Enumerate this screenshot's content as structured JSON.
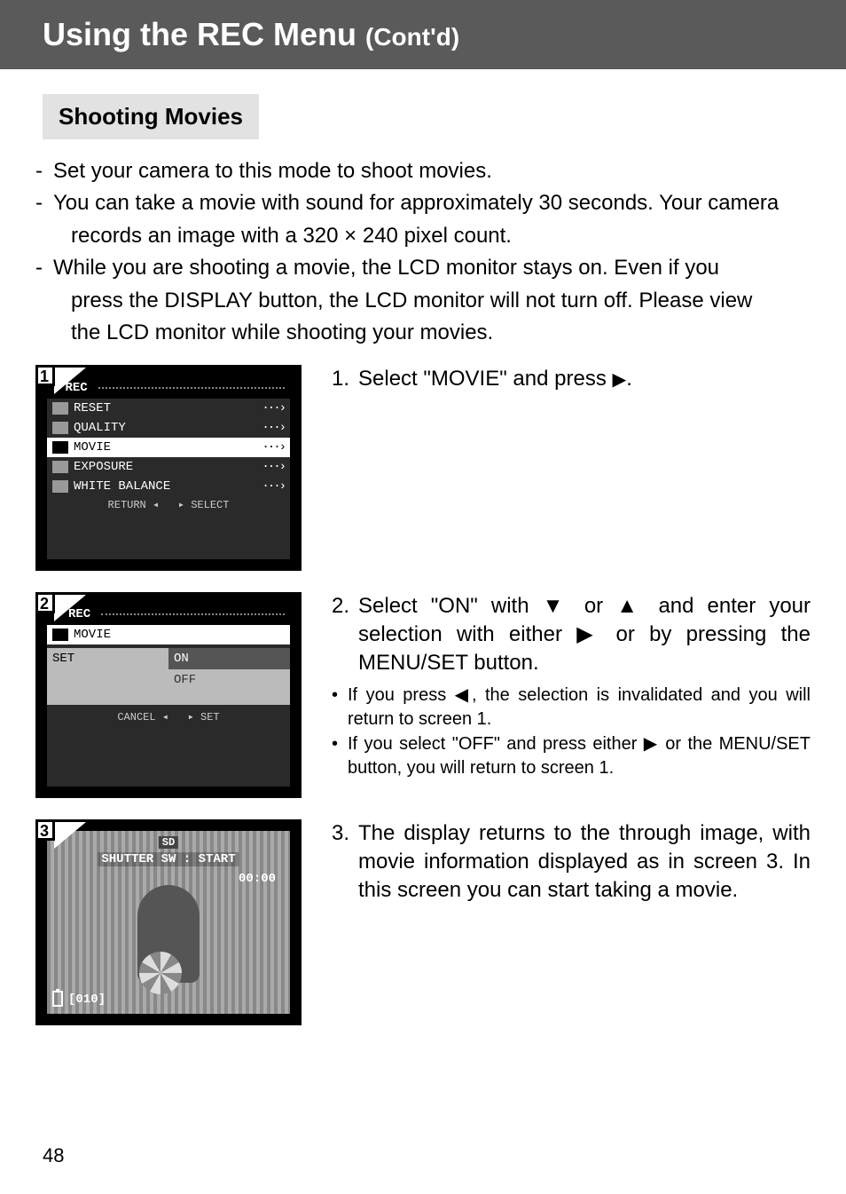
{
  "header": {
    "main": "Using the REC Menu ",
    "sub": "(Cont'd)"
  },
  "section_title": "Shooting Movies",
  "intro": {
    "l1": "Set your camera to this mode to shoot movies.",
    "l2a": "You can take a movie with sound for approximately 30 seconds. Your camera",
    "l2b": "records an image with a 320 × 240 pixel count.",
    "l3a": "While you are shooting a movie, the LCD monitor stays on. Even if you",
    "l3b": "press the DISPLAY button, the LCD monitor will not turn off. Please view",
    "l3c": "the LCD monitor while shooting your movies."
  },
  "screen1": {
    "num": "1",
    "title": "REC",
    "items": [
      "RESET",
      "QUALITY",
      "MOVIE",
      "EXPOSURE",
      "WHITE BALANCE"
    ],
    "selected_index": 2,
    "foot_left": "RETURN",
    "foot_right": "SELECT"
  },
  "step1": {
    "n": "1.",
    "text_a": "Select \"MOVIE\" and press ",
    "text_b": "."
  },
  "screen2": {
    "num": "2",
    "title": "REC",
    "movie_label": "MOVIE",
    "set_label": "SET",
    "on": "ON",
    "off": "OFF",
    "foot_left": "CANCEL",
    "foot_right": "SET"
  },
  "step2": {
    "n": "2.",
    "line": "Select \"ON\" with ▼ or ▲ and enter your selection with either ▶ or by pressing the MENU/SET button.",
    "b1": "If you press ◀, the selection is invalidated and you will return to screen 1.",
    "b2": "If you select \"OFF\" and press either ▶ or the MENU/SET button, you will return to screen 1."
  },
  "screen3": {
    "num": "3",
    "sd": "SD",
    "shutter": "SHUTTER SW : START",
    "time": "00:00",
    "count": "[010]"
  },
  "step3": {
    "n": "3.",
    "line": "The display returns to the through image, with movie information displayed as in screen 3. In this screen you can start taking a movie."
  },
  "page_number": "48"
}
